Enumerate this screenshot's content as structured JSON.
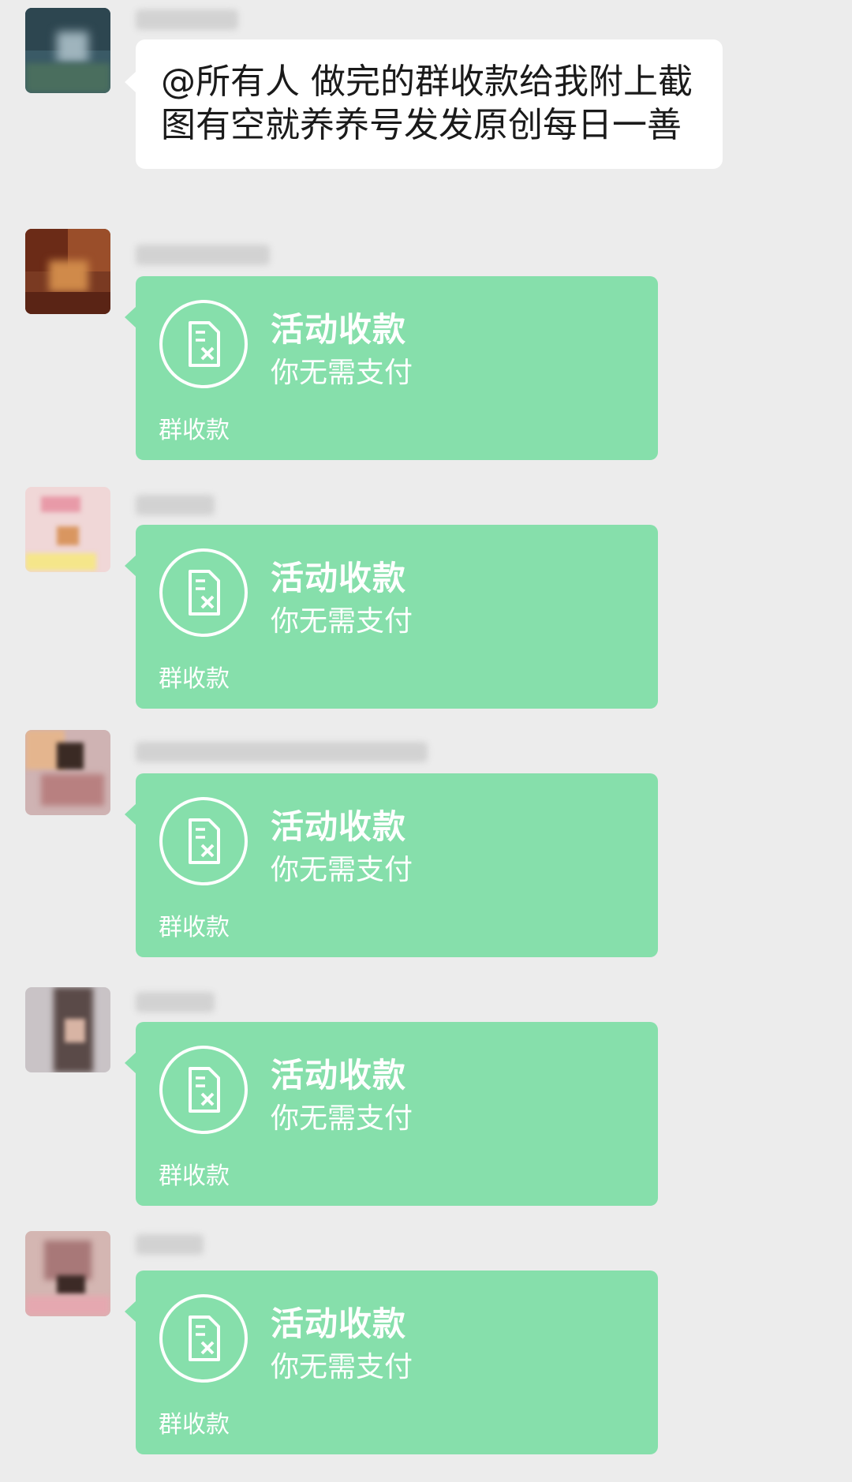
{
  "announcement": {
    "text": "@所有人  做完的群收款给我附上截图有空就养养号发发原创每日一善"
  },
  "payment_card": {
    "title": "活动收款",
    "subtitle": "你无需支付",
    "tag": "群收款",
    "icon": "receipt-x-icon"
  },
  "payment_messages": [
    {
      "title": "活动收款",
      "subtitle": "你无需支付",
      "tag": "群收款"
    },
    {
      "title": "活动收款",
      "subtitle": "你无需支付",
      "tag": "群收款"
    },
    {
      "title": "活动收款",
      "subtitle": "你无需支付",
      "tag": "群收款"
    },
    {
      "title": "活动收款",
      "subtitle": "你无需支付",
      "tag": "群收款"
    },
    {
      "title": "活动收款",
      "subtitle": "你无需支付",
      "tag": "群收款"
    }
  ],
  "colors": {
    "background": "#ececec",
    "text_bubble": "#ffffff",
    "payment_bubble": "#86dfab"
  }
}
